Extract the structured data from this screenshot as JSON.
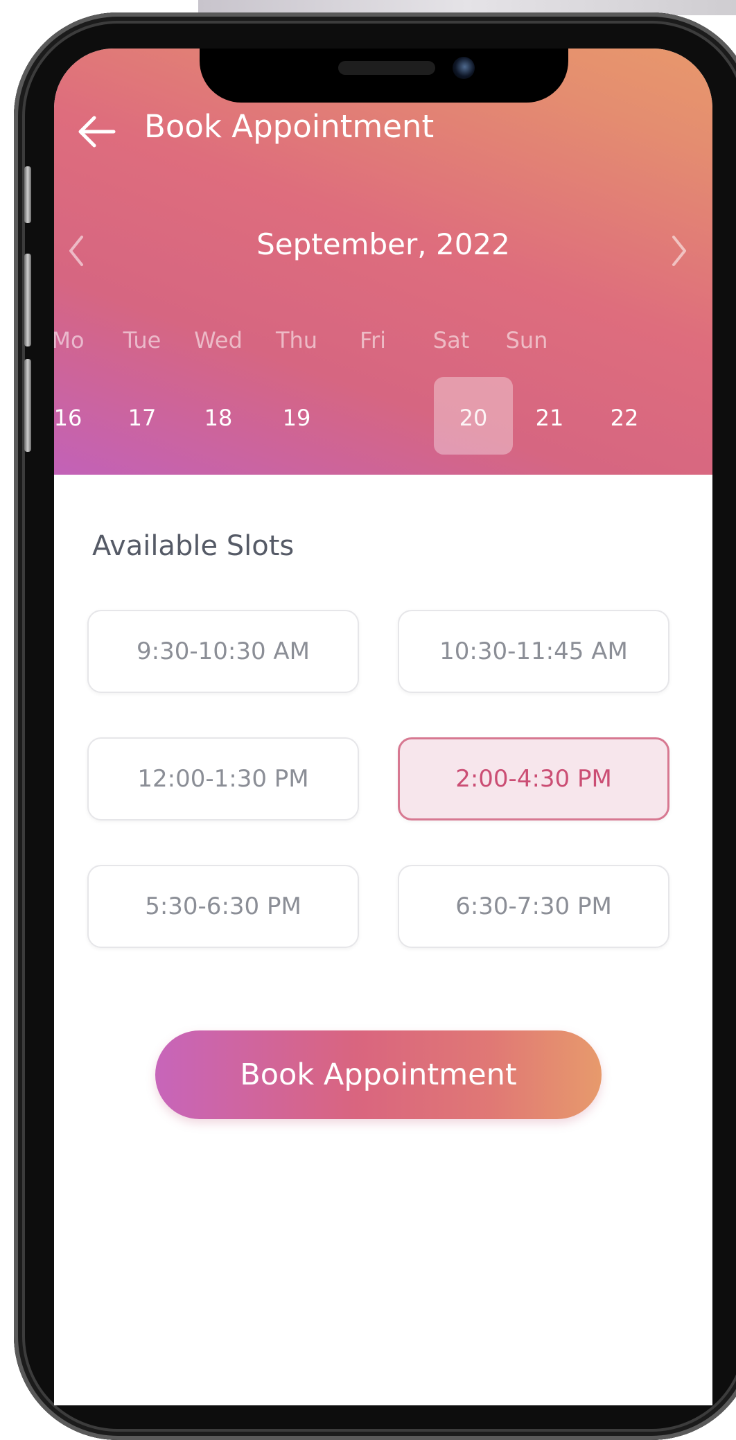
{
  "header": {
    "title": "Book Appointment"
  },
  "calendar": {
    "month_label": "September, 2022",
    "weekdays": [
      "Mo",
      "Tue",
      "Wed",
      "Thu",
      "Fri",
      "Sat",
      "Sun"
    ],
    "days": [
      "16",
      "17",
      "18",
      "19",
      "20",
      "21",
      "22"
    ],
    "selected_day": "20"
  },
  "slots": {
    "title": "Available Slots",
    "items": [
      {
        "label": "9:30-10:30 AM",
        "selected": false
      },
      {
        "label": "10:30-11:45 AM",
        "selected": false
      },
      {
        "label": "12:00-1:30 PM",
        "selected": false
      },
      {
        "label": "2:00-4:30 PM",
        "selected": true
      },
      {
        "label": "5:30-6:30 PM",
        "selected": false
      },
      {
        "label": "6:30-7:30 PM",
        "selected": false
      }
    ]
  },
  "actions": {
    "book_label": "Book Appointment"
  },
  "colors": {
    "gradient_start": "#c262b8",
    "gradient_mid": "#de6d7d",
    "gradient_end": "#e8986c",
    "selected_slot_bg": "#f7e6ec",
    "selected_slot_text": "#cb4e74"
  }
}
